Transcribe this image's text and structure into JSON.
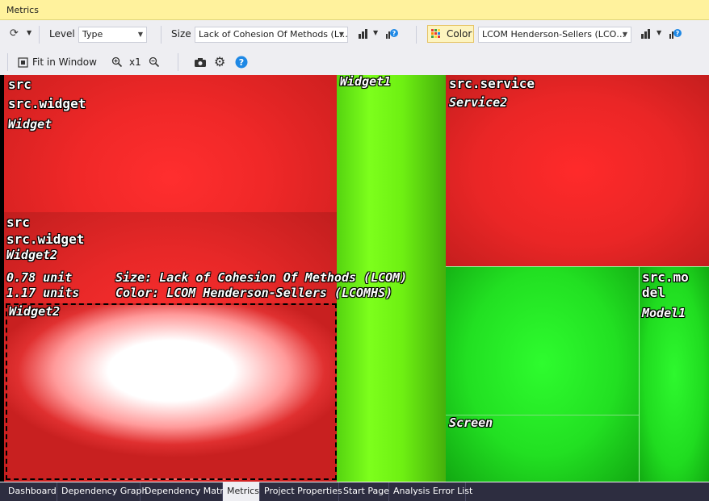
{
  "window": {
    "title": "Metrics"
  },
  "toolbar": {
    "level_label": "Level",
    "level_value": "Type",
    "size_label": "Size",
    "size_value": "Lack of Cohesion Of Methods (L…",
    "color_label": "Color",
    "color_value": "LCOM Henderson-Sellers (LCO…",
    "fit_label": "Fit in Window",
    "zoom_label": "x1"
  },
  "treemap": {
    "cells": [
      {
        "name": "Widget",
        "label_lines": [
          "src",
          "src.widget",
          "Widget"
        ]
      },
      {
        "name": "Widget2",
        "label_lines": [
          "src",
          "src.widget",
          "Widget2"
        ],
        "inner_label": "Widget2"
      },
      {
        "name": "Widget1",
        "label_lines": [
          "Widget1"
        ]
      },
      {
        "name": "Service2",
        "label_lines": [
          "src.service",
          "Service2"
        ]
      },
      {
        "name": "Screen",
        "label_lines": [
          "Screen"
        ]
      },
      {
        "name": "Model1",
        "label_lines": [
          "src.mo",
          "del",
          "Model1"
        ]
      }
    ],
    "tooltip": {
      "size_value": "0.78 unit",
      "color_value": "1.17 units",
      "size_metric": "Size: Lack of Cohesion Of Methods (LCOM)",
      "color_metric": "Color: LCOM Henderson-Sellers (LCOMHS)"
    }
  },
  "tabs": [
    {
      "label": "Dashboard",
      "active": false
    },
    {
      "label": "Dependency Graph",
      "active": false
    },
    {
      "label": "Dependency Matrix",
      "active": false
    },
    {
      "label": "Metrics",
      "active": true
    },
    {
      "label": "Project Properties",
      "active": false
    },
    {
      "label": "Start Page",
      "active": false
    },
    {
      "label": "Analysis Error List",
      "active": false
    }
  ],
  "colors": {
    "high": "#e82a2a",
    "low": "#2ee82e",
    "selected": "#ffffff"
  }
}
